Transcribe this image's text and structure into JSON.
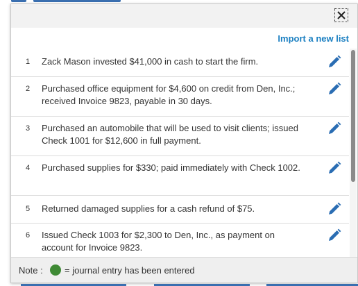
{
  "dialog": {
    "close_icon": "close-x-icon",
    "import_link": "Import a new list"
  },
  "transactions": [
    {
      "num": "1",
      "text": "Zack Mason invested $41,000 in cash to start the firm."
    },
    {
      "num": "2",
      "text": "Purchased office equipment for $4,600 on credit from Den, Inc.; received Invoice 9823, payable in 30 days."
    },
    {
      "num": "3",
      "text": "Purchased an automobile that will be used to visit clients; issued Check 1001 for $12,600 in full payment."
    },
    {
      "num": "4",
      "text": "Purchased supplies for $330; paid immediately with Check 1002."
    },
    {
      "num": "5",
      "text": "Returned damaged supplies for a cash refund of $75."
    },
    {
      "num": "6",
      "text": "Issued Check 1003 for $2,300 to Den, Inc., as payment on account for Invoice 9823."
    }
  ],
  "footer": {
    "note_label": "Note :",
    "note_text": "= journal entry has been entered",
    "indicator_color": "#3f8a35"
  },
  "colors": {
    "accent": "#1a7fc1",
    "edit_icon": "#2a6db3",
    "entered": "#3f8a35"
  },
  "icons": {
    "edit": "pencil-icon",
    "close": "close-x-icon",
    "entered_indicator": "green-dot-icon"
  }
}
